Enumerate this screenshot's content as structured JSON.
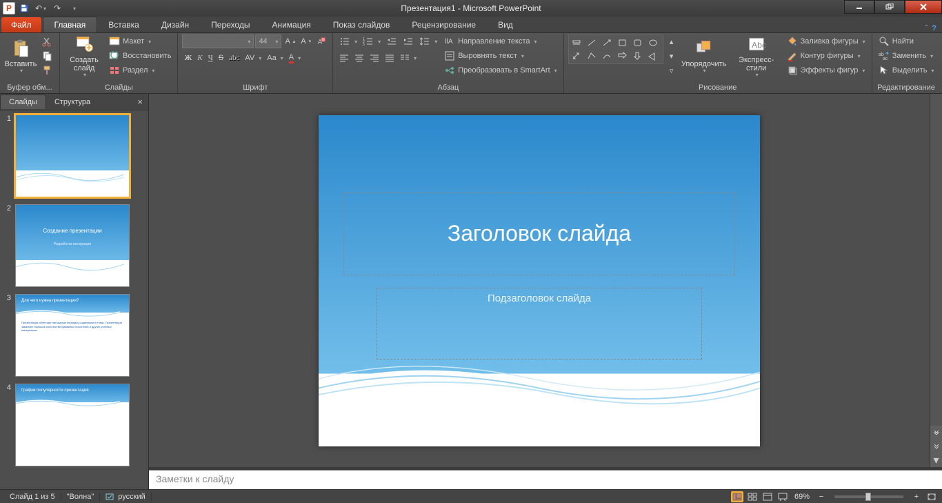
{
  "title": "Презентация1 - Microsoft PowerPoint",
  "qat": {
    "save": "💾",
    "undo": "↶",
    "redo": "↷"
  },
  "tabs": {
    "file": "Файл",
    "items": [
      "Главная",
      "Вставка",
      "Дизайн",
      "Переходы",
      "Анимация",
      "Показ слайдов",
      "Рецензирование",
      "Вид"
    ],
    "active": 0
  },
  "ribbon": {
    "clipboard": {
      "label": "Буфер обм...",
      "paste": "Вставить"
    },
    "slides": {
      "label": "Слайды",
      "new": "Создать слайд",
      "layout": "Макет",
      "reset": "Восстановить",
      "section": "Раздел"
    },
    "font": {
      "label": "Шрифт",
      "size": "44"
    },
    "paragraph": {
      "label": "Абзац",
      "textdir": "Направление текста",
      "align": "Выровнять текст",
      "smartart": "Преобразовать в SmartArt"
    },
    "drawing": {
      "label": "Рисование",
      "arrange": "Упорядочить",
      "styles": "Экспресс-стили",
      "fill": "Заливка фигуры",
      "outline": "Контур фигуры",
      "effects": "Эффекты фигур"
    },
    "editing": {
      "label": "Редактирование",
      "find": "Найти",
      "replace": "Заменить",
      "select": "Выделить"
    }
  },
  "sidepanel": {
    "tabs": [
      "Слайды",
      "Структура"
    ],
    "active": 0
  },
  "slides": [
    {
      "num": "1",
      "title": "",
      "sub": ""
    },
    {
      "num": "2",
      "title": "Создание презентации",
      "sub": "Разработка инструкции"
    },
    {
      "num": "3",
      "h2": "Для чего нужна презентация?",
      "body": "Презентация облегчает наглядную передачу содержимого темы. Презентация заменяет большое количество бумажных носителей и других учебных материалов."
    },
    {
      "num": "4",
      "h2": "График популярности презентаций",
      "body": ""
    }
  ],
  "canvas": {
    "title_ph": "Заголовок слайда",
    "sub_ph": "Подзаголовок слайда"
  },
  "notes": {
    "placeholder": "Заметки к слайду"
  },
  "status": {
    "slide": "Слайд 1 из 5",
    "theme": "\"Волна\"",
    "lang": "русский",
    "zoom": "69%"
  }
}
